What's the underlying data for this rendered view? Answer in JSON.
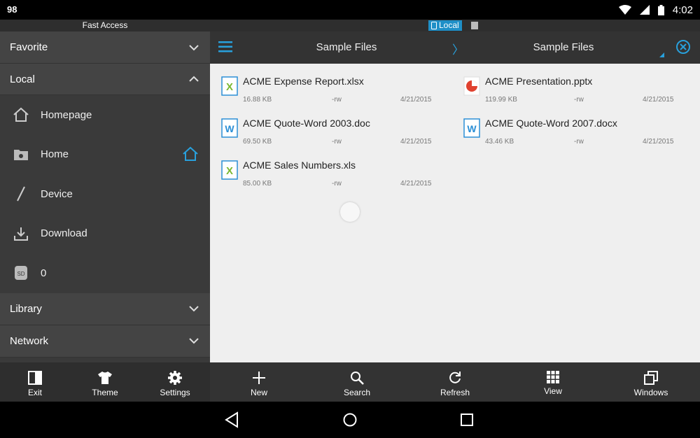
{
  "status_bar": {
    "notification": "98",
    "time": "4:02"
  },
  "sidebar": {
    "header": "Fast Access",
    "favorite": "Favorite",
    "local": "Local",
    "items": [
      {
        "label": "Homepage",
        "icon": "house-icon"
      },
      {
        "label": "Home",
        "icon": "folder-icon"
      },
      {
        "label": "Device",
        "icon": "slash-icon"
      },
      {
        "label": "Download",
        "icon": "download-icon"
      },
      {
        "label": "0",
        "icon": "sd-card-icon"
      }
    ],
    "library": "Library",
    "network": "Network"
  },
  "tabs": {
    "active": "Local"
  },
  "toolbar": {
    "title_left": "Sample Files",
    "title_right": "Sample Files"
  },
  "files": [
    {
      "name": "ACME Expense Report.xlsx",
      "size": "16.88 KB",
      "perm": "-rw",
      "date": "4/21/2015",
      "type": "excel"
    },
    {
      "name": "ACME Presentation.pptx",
      "size": "119.99 KB",
      "perm": "-rw",
      "date": "4/21/2015",
      "type": "powerpoint"
    },
    {
      "name": "ACME Quote-Word 2003.doc",
      "size": "69.50 KB",
      "perm": "-rw",
      "date": "4/21/2015",
      "type": "word"
    },
    {
      "name": "ACME Quote-Word 2007.docx",
      "size": "43.46 KB",
      "perm": "-rw",
      "date": "4/21/2015",
      "type": "word"
    },
    {
      "name": "ACME Sales Numbers.xls",
      "size": "85.00 KB",
      "perm": "-rw",
      "date": "4/21/2015",
      "type": "excel"
    }
  ],
  "bottom_left": {
    "exit": "Exit",
    "theme": "Theme",
    "settings": "Settings"
  },
  "bottom_right": {
    "new": "New",
    "search": "Search",
    "refresh": "Refresh",
    "view": "View",
    "windows": "Windows"
  },
  "colors": {
    "accent": "#28a0dc",
    "excel": "#7ab830",
    "word": "#2b8fd6",
    "powerpoint": "#e0412f"
  }
}
